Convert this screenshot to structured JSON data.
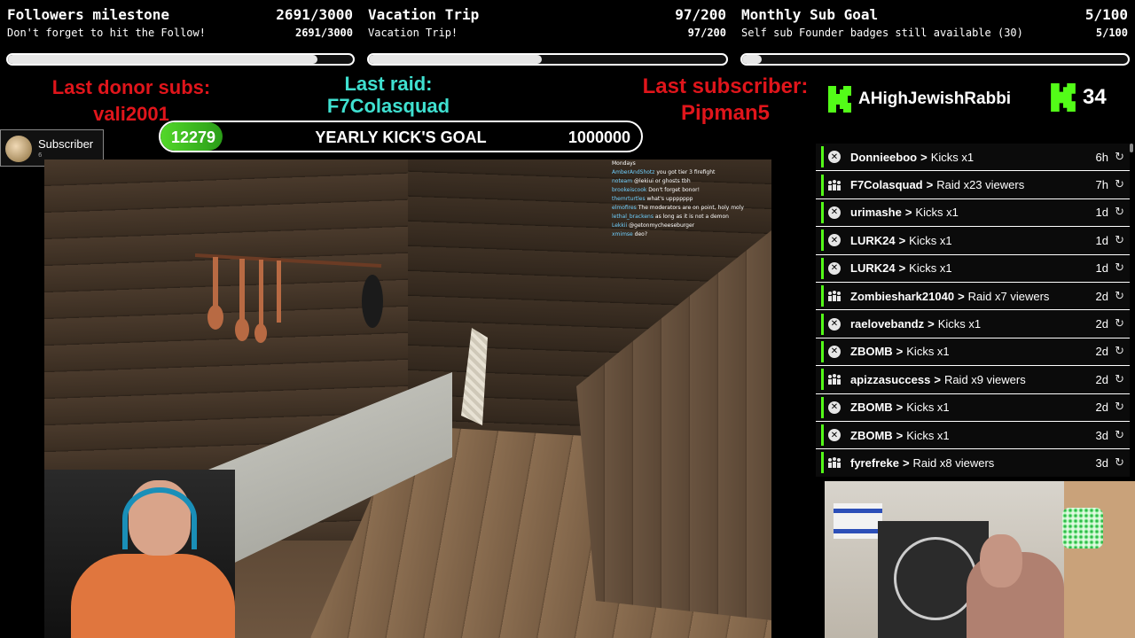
{
  "goals": [
    {
      "title": "Followers milestone",
      "count": "2691/3000",
      "subtitle": "Don't forget to hit the Follow!",
      "progress": 0.897
    },
    {
      "title": "Vacation Trip",
      "count": "97/200",
      "subtitle": "Vacation Trip!",
      "progress": 0.485
    },
    {
      "title": "Monthly Sub Goal",
      "count": "5/100",
      "subtitle": "Self sub Founder badges still available (30)",
      "progress": 0.05
    }
  ],
  "labels": {
    "donor_title": "Last donor subs:",
    "donor_name": "vali2001",
    "raid_title": "Last raid:",
    "raid_name": "F7Colasquad",
    "sub_title": "Last subscriber:",
    "sub_name": "Pipman5"
  },
  "yearly_goal": {
    "current": "12279",
    "title": "YEARLY KICK'S GOAL",
    "target": "1000000",
    "progress": 0.0123
  },
  "subscriber_badge": {
    "label": "Subscriber",
    "count": "6"
  },
  "kick_header": {
    "username": "AHighJewishRabbi",
    "count": "34"
  },
  "colors": {
    "kick_green": "#53fc18",
    "red": "#e0151b",
    "cyan": "#3fe0d0"
  },
  "mini_chat": [
    {
      "user": "",
      "msg": "Mondays"
    },
    {
      "user": "AmberAndShotz",
      "msg": "you got tier 3 firefight"
    },
    {
      "user": "noteam",
      "msg": "@lekiui or ghosts tbh"
    },
    {
      "user": "brookeiscook",
      "msg": "Don't forget bonor!"
    },
    {
      "user": "themrturtles",
      "msg": "what's uppppppp"
    },
    {
      "user": "elmofires",
      "msg": "The moderators are on point, holy moly"
    },
    {
      "user": "lethal_brackens",
      "msg": "as long as it is not a demon"
    },
    {
      "user": "Lekkii",
      "msg": "@getonmycheeseburger"
    },
    {
      "user": "xmimse",
      "msg": "deo?"
    }
  ],
  "events": [
    {
      "icon": "kick",
      "name": "Donnieeboo",
      "action": "Kicks x1",
      "time": "6h"
    },
    {
      "icon": "raid",
      "name": "F7Colasquad",
      "action": "Raid x23 viewers",
      "time": "7h"
    },
    {
      "icon": "kick",
      "name": "urimashe",
      "action": "Kicks x1",
      "time": "1d"
    },
    {
      "icon": "kick",
      "name": "LURK24",
      "action": "Kicks x1",
      "time": "1d"
    },
    {
      "icon": "kick",
      "name": "LURK24",
      "action": "Kicks x1",
      "time": "1d"
    },
    {
      "icon": "raid",
      "name": "Zombieshark21040",
      "action": "Raid x7 viewers",
      "time": "2d"
    },
    {
      "icon": "kick",
      "name": "raelovebandz",
      "action": "Kicks x1",
      "time": "2d"
    },
    {
      "icon": "kick",
      "name": "ZBOMB",
      "action": "Kicks x1",
      "time": "2d"
    },
    {
      "icon": "raid",
      "name": "apizzasuccess",
      "action": "Raid x9 viewers",
      "time": "2d"
    },
    {
      "icon": "kick",
      "name": "ZBOMB",
      "action": "Kicks x1",
      "time": "2d"
    },
    {
      "icon": "kick",
      "name": "ZBOMB",
      "action": "Kicks x1",
      "time": "3d"
    },
    {
      "icon": "raid",
      "name": "fyrefreke",
      "action": "Raid x8 viewers",
      "time": "3d"
    }
  ]
}
